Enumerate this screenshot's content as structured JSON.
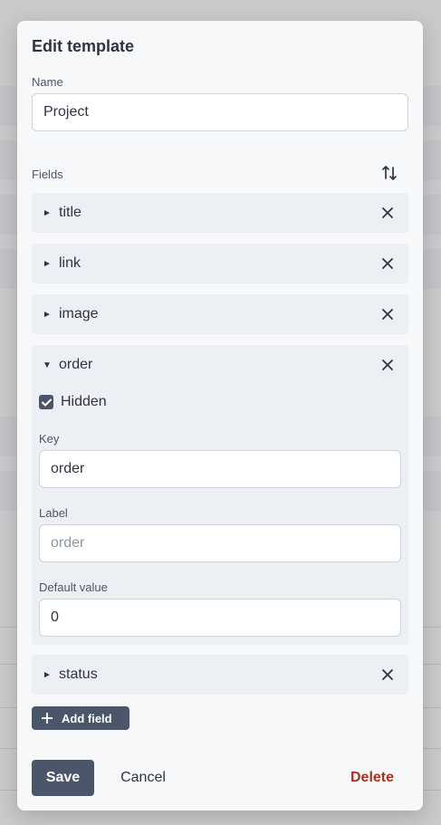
{
  "modal": {
    "title": "Edit template",
    "name_label": "Name",
    "name_value": "Project",
    "fields_label": "Fields"
  },
  "fields": [
    {
      "name": "title",
      "expanded": false
    },
    {
      "name": "link",
      "expanded": false
    },
    {
      "name": "image",
      "expanded": false
    },
    {
      "name": "order",
      "expanded": true,
      "hidden_label": "Hidden",
      "hidden_checked": true,
      "key_label": "Key",
      "key_value": "order",
      "label_label": "Label",
      "label_placeholder": "order",
      "label_value": "",
      "default_label": "Default value",
      "default_value": "0"
    },
    {
      "name": "status",
      "expanded": false
    }
  ],
  "actions": {
    "add_field_label": "Add field",
    "save_label": "Save",
    "cancel_label": "Cancel",
    "delete_label": "Delete"
  },
  "icons": {
    "collapsed": "caret-right-icon",
    "expanded": "caret-down-icon",
    "remove": "close-icon",
    "sort": "sort-arrows-icon",
    "add": "plus-icon",
    "check": "checkmark-icon"
  },
  "colors": {
    "primary": "#4c566a",
    "danger": "#a8321f",
    "panel": "#f7f8fa",
    "row": "#eceff3"
  }
}
